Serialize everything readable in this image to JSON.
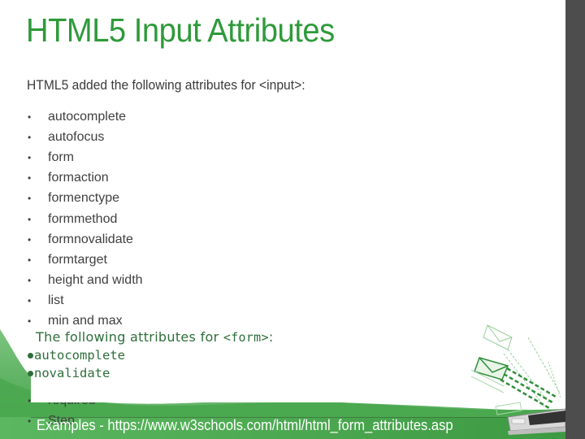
{
  "slide": {
    "title": "HTML5 Input Attributes",
    "intro": "HTML5 added the following attributes for <input>:",
    "bullet": "•",
    "input_attributes": [
      "autocomplete",
      "autofocus",
      "form",
      "formaction",
      "formenctype",
      "formmethod",
      "formnovalidate",
      "formtarget",
      "height and width",
      "list",
      "min and max"
    ],
    "hidden_items_partial": [
      "required",
      "Step"
    ],
    "form_section": {
      "heading_prefix": "The following attributes for ",
      "heading_code": "<form>",
      "heading_suffix": ":",
      "items": [
        "autocomplete",
        "novalidate"
      ]
    },
    "footer": "Examples - https://www.w3schools.com/html/html_form_attributes.asp"
  },
  "colors": {
    "title": "#2e9a3a",
    "body_text": "#404040",
    "overlay_text": "#2f6e3b",
    "wave_green": "#4caf50",
    "side_strip": "#4d4d4d"
  },
  "icons": {
    "decoration": "laptop-with-envelopes-icon"
  }
}
